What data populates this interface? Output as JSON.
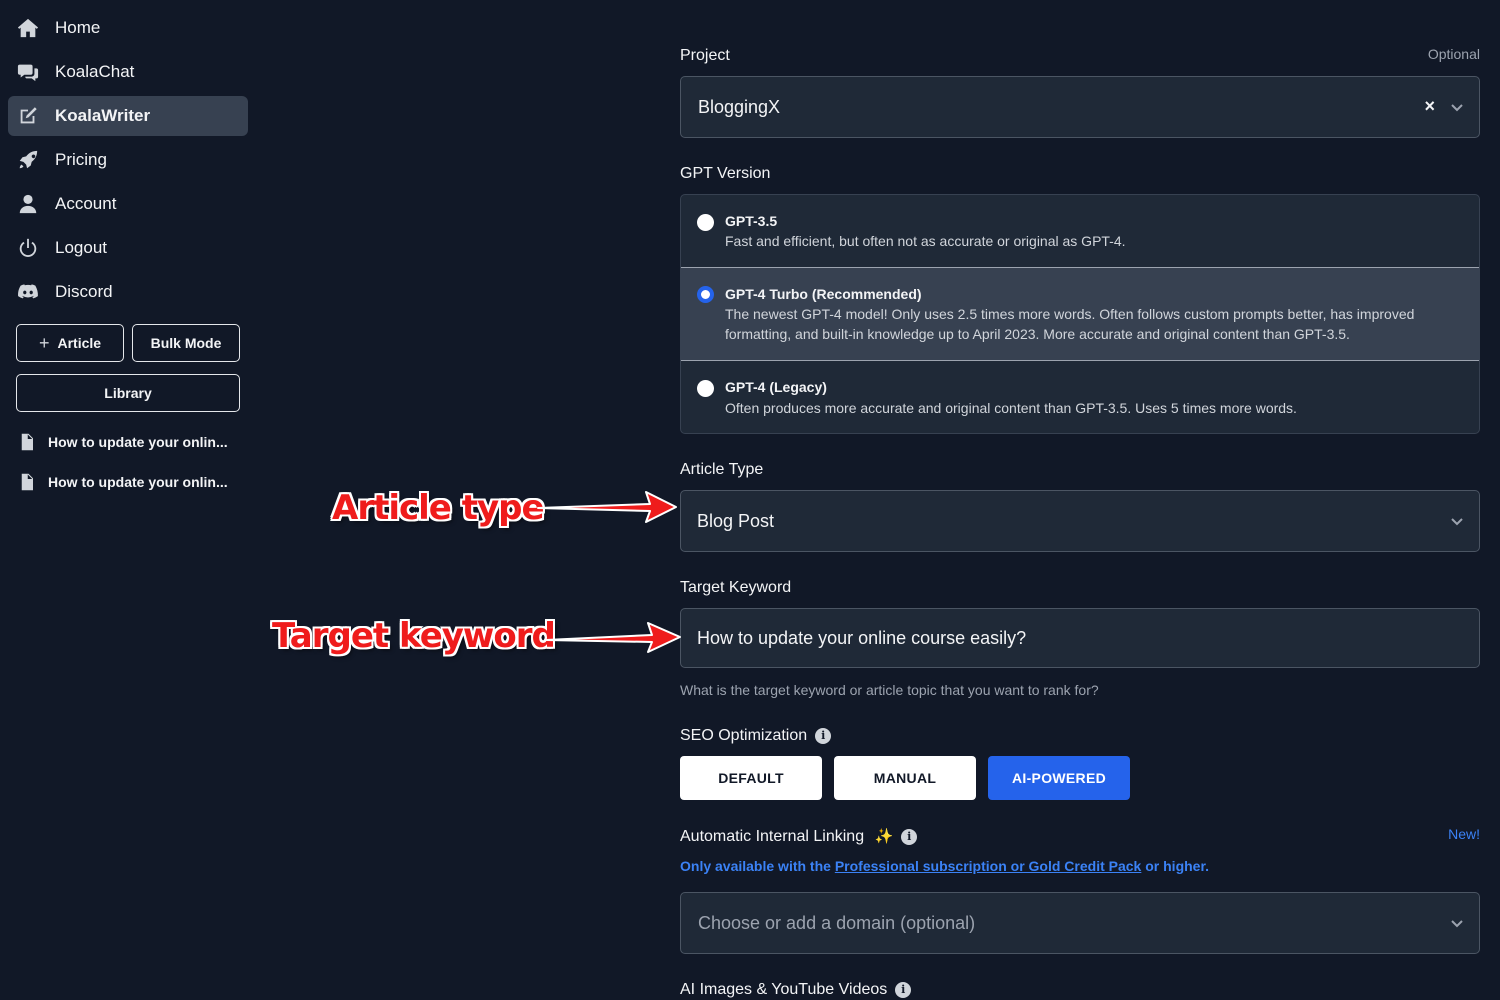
{
  "sidebar": {
    "nav": [
      {
        "label": "Home",
        "icon": "home-icon"
      },
      {
        "label": "KoalaChat",
        "icon": "chat-icon"
      },
      {
        "label": "KoalaWriter",
        "icon": "edit-icon"
      },
      {
        "label": "Pricing",
        "icon": "rocket-icon"
      },
      {
        "label": "Account",
        "icon": "user-icon"
      },
      {
        "label": "Logout",
        "icon": "power-icon"
      },
      {
        "label": "Discord",
        "icon": "discord-icon"
      }
    ],
    "article_btn": "Article",
    "bulk_btn": "Bulk Mode",
    "library_btn": "Library",
    "docs": [
      "How to update your onlin...",
      "How to update your onlin..."
    ]
  },
  "form": {
    "project_label": "Project",
    "project_optional": "Optional",
    "project_value": "BloggingX",
    "gpt_label": "GPT Version",
    "gpt_options": [
      {
        "title": "GPT-3.5",
        "desc": "Fast and efficient, but often not as accurate or original as GPT-4."
      },
      {
        "title": "GPT-4 Turbo (Recommended)",
        "desc": "The newest GPT-4 model! Only uses 2.5 times more words. Often follows custom prompts better, has improved formatting, and built-in knowledge up to April 2023. More accurate and original content than GPT-3.5."
      },
      {
        "title": "GPT-4 (Legacy)",
        "desc": "Often produces more accurate and original content than GPT-3.5. Uses 5 times more words."
      }
    ],
    "article_type_label": "Article Type",
    "article_type_value": "Blog Post",
    "keyword_label": "Target Keyword",
    "keyword_value": "How to update your online course easily?",
    "keyword_help": "What is the target keyword or article topic that you want to rank for?",
    "seo_label": "SEO Optimization",
    "seo_options": [
      "DEFAULT",
      "MANUAL",
      "AI-POWERED"
    ],
    "linking_label": "Automatic Internal Linking",
    "linking_new": "New!",
    "linking_note_pre": "Only available with the ",
    "linking_note_link": "Professional subscription or Gold Credit Pack",
    "linking_note_post": " or higher.",
    "domain_placeholder": "Choose or add a domain (optional)",
    "media_label": "AI Images & YouTube Videos"
  },
  "annotations": {
    "article_type": "Article type",
    "target_keyword": "Target keyword"
  },
  "colors": {
    "background": "#111827",
    "accent": "#2563eb",
    "link": "#3b82f6",
    "annotation": "#ef1c1c"
  }
}
